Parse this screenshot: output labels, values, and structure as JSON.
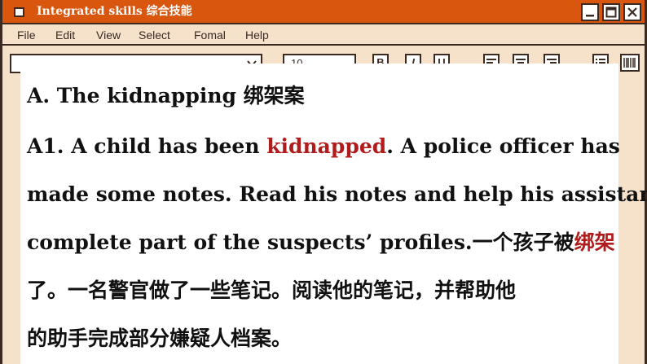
{
  "window": {
    "title": "Integrated skills 综合技能"
  },
  "menu": [
    "File",
    "Edit",
    "View",
    "Select",
    "Fomal",
    "Help"
  ],
  "toolbar": {
    "font_size": "10",
    "bold_label": "B",
    "italic_label": "I",
    "underline_label": "U"
  },
  "content": {
    "heading": "A. The kidnapping 绑架案",
    "p1_a": "A1. A child has been ",
    "p1_hl": "kidnapped",
    "p1_b": ". A police officer has",
    "p2": "made some notes. Read his notes and help his assistant",
    "p3_a": "complete part of the suspects’  profiles.一个孩子被",
    "p3_hl": "绑架",
    "p4": "了。一名警官做了一些笔记。阅读他的笔记，并帮助他",
    "p5": "的助手完成部分嫌疑人档案。"
  },
  "colors": {
    "titlebar": "#d9560f",
    "background": "#f6e2cb",
    "highlight": "#b01c1c"
  }
}
